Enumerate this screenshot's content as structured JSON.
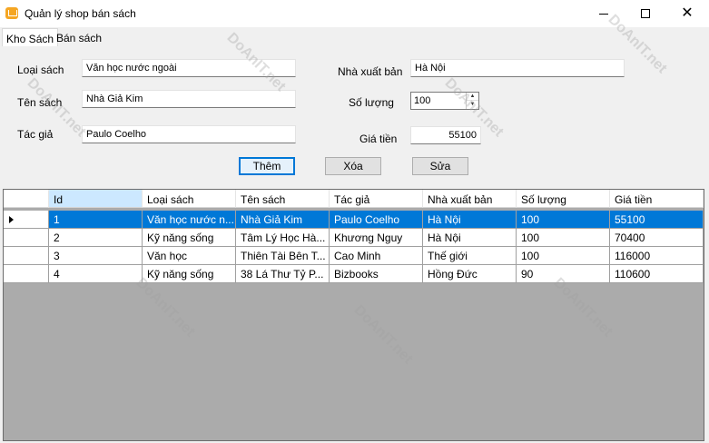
{
  "window": {
    "title": "Quản lý shop bán sách",
    "accent_color": "#0078d7"
  },
  "tabs": [
    {
      "label": "Kho Sách",
      "active": true
    },
    {
      "label": "Bán sách",
      "active": false
    }
  ],
  "form": {
    "loai_sach_label": "Loại sách",
    "loai_sach_value": "Văn học nước ngoài",
    "ten_sach_label": "Tên sách",
    "ten_sach_value": "Nhà Giả Kim",
    "tac_gia_label": "Tác giả",
    "tac_gia_value": "Paulo Coelho",
    "nha_xuat_ban_label": "Nhà xuất bản",
    "nha_xuat_ban_value": "Hà Nội",
    "so_luong_label": "Số lượng",
    "so_luong_value": "100",
    "gia_tien_label": "Giá tiền",
    "gia_tien_value": "55100"
  },
  "buttons": {
    "them": "Thêm",
    "xoa": "Xóa",
    "sua": "Sửa"
  },
  "grid": {
    "columns": [
      "Id",
      "Loại sách",
      "Tên sách",
      "Tác giả",
      "Nhà xuất bản",
      "Số lượng",
      "Giá tiền"
    ],
    "rows": [
      [
        "1",
        "Văn học nước n...",
        "Nhà Giả Kim",
        "Paulo Coelho",
        "Hà Nội",
        "100",
        "55100"
      ],
      [
        "2",
        "Kỹ năng sống",
        "Tâm Lý Học Hà...",
        "Khương Nguy",
        "Hà Nội",
        "100",
        "70400"
      ],
      [
        "3",
        "Văn học",
        "Thiên Tài Bên T...",
        "Cao Minh",
        "Thế giới",
        "100",
        "116000"
      ],
      [
        "4",
        "Kỹ năng sống",
        "38 Lá Thư Tỷ P...",
        "Bizbooks",
        "Hồng Đức",
        "90",
        "110600"
      ]
    ],
    "selected_row": 0
  },
  "watermark": "DoAnIT.net"
}
